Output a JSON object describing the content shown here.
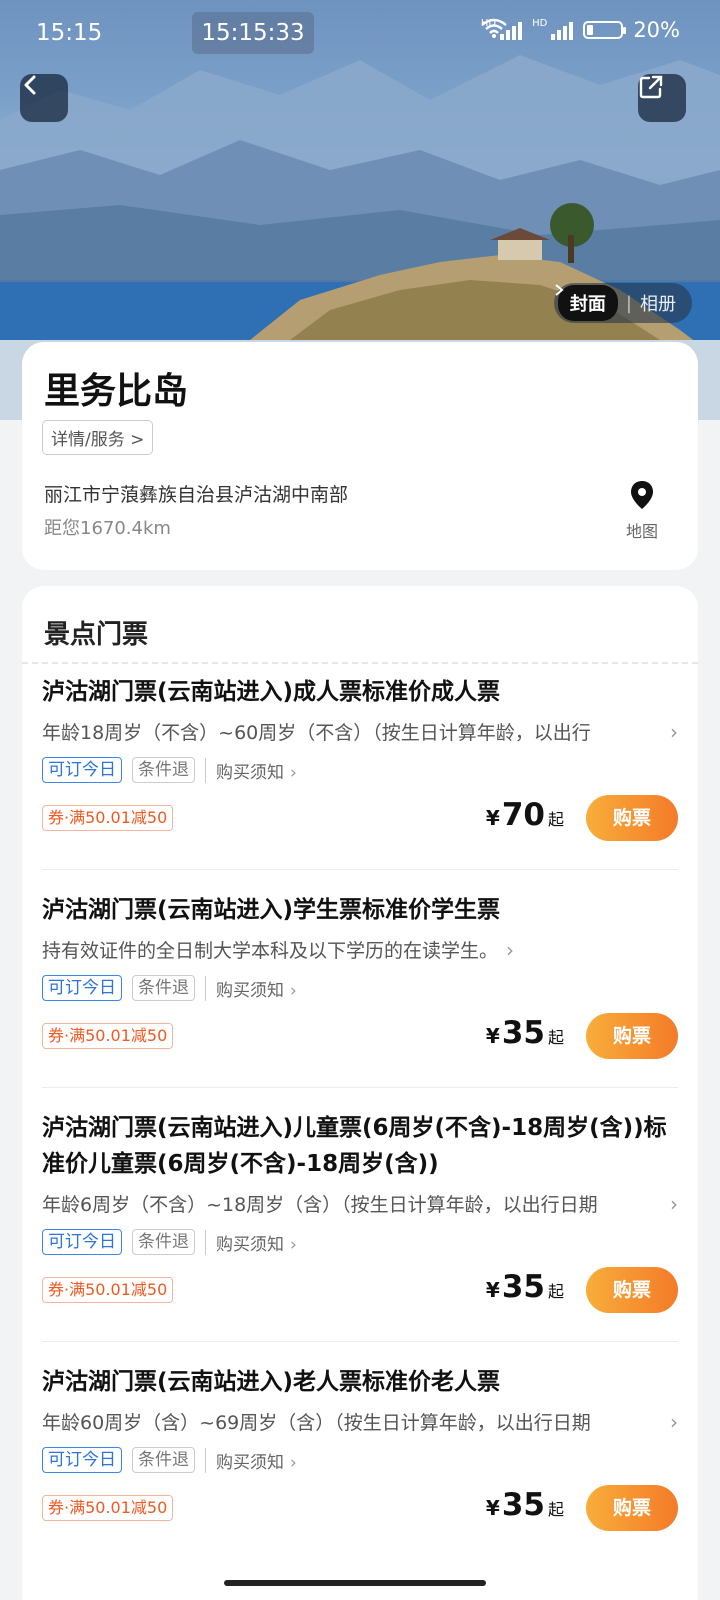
{
  "status_bar": {
    "time": "15:15",
    "clock": "15:15:33",
    "network1": "HD",
    "network2": "HD",
    "battery": "20%"
  },
  "album": {
    "cover": "封面",
    "gallery": "相册"
  },
  "spot": {
    "title": "里务比岛",
    "details_label": "详情/服务 >",
    "address": "丽江市宁蒗彝族自治县泸沽湖中南部",
    "distance": "距您1670.4km",
    "map_label": "地图"
  },
  "tickets_section": {
    "title": "景点门票",
    "items": [
      {
        "name": "泸沽湖门票(云南站进入)成人票标准价成人票",
        "desc": "年龄18周岁（不含）~60周岁（不含）（按生日计算年龄，以出行",
        "tag1": "可订今日",
        "tag2": "条件退",
        "notice": "购买须知",
        "coupon": "券·满50.01减50",
        "currency": "¥",
        "price": "70",
        "price_suffix": "起",
        "buy": "购票"
      },
      {
        "name": "泸沽湖门票(云南站进入)学生票标准价学生票",
        "desc": "持有效证件的全日制大学本科及以下学历的在读学生。",
        "tag1": "可订今日",
        "tag2": "条件退",
        "notice": "购买须知",
        "coupon": "券·满50.01减50",
        "currency": "¥",
        "price": "35",
        "price_suffix": "起",
        "buy": "购票"
      },
      {
        "name": "泸沽湖门票(云南站进入)儿童票(6周岁(不含)-18周岁(含))标准价儿童票(6周岁(不含)-18周岁(含))",
        "desc": "年龄6周岁（不含）~18周岁（含）（按生日计算年龄，以出行日期",
        "tag1": "可订今日",
        "tag2": "条件退",
        "notice": "购买须知",
        "coupon": "券·满50.01减50",
        "currency": "¥",
        "price": "35",
        "price_suffix": "起",
        "buy": "购票"
      },
      {
        "name": "泸沽湖门票(云南站进入)老人票标准价老人票",
        "desc": "年龄60周岁（含）~69周岁（含）（按生日计算年龄，以出行日期",
        "tag1": "可订今日",
        "tag2": "条件退",
        "notice": "购买须知",
        "coupon": "券·满50.01减50",
        "currency": "¥",
        "price": "35",
        "price_suffix": "起",
        "buy": "购票"
      }
    ]
  }
}
